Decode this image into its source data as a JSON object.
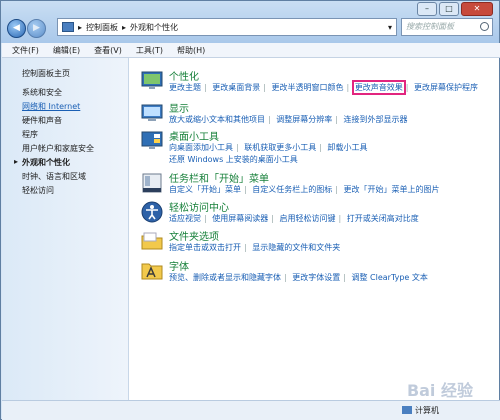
{
  "address": {
    "crumbs": [
      "控制面板",
      "外观和个性化"
    ]
  },
  "search": {
    "placeholder": "搜索控制面板"
  },
  "menubar": [
    "文件(F)",
    "编辑(E)",
    "查看(V)",
    "工具(T)",
    "帮助(H)"
  ],
  "sidebar": {
    "items": [
      {
        "label": "控制面板主页"
      },
      {
        "label": "系统和安全"
      },
      {
        "label": "网络和 Internet"
      },
      {
        "label": "硬件和声音"
      },
      {
        "label": "程序"
      },
      {
        "label": "用户帐户和家庭安全"
      },
      {
        "label": "外观和个性化"
      },
      {
        "label": "时钟、语言和区域"
      },
      {
        "label": "轻松访问"
      }
    ]
  },
  "categories": [
    {
      "title": "个性化",
      "links": [
        "更改主题",
        "更改桌面背景",
        "更改半透明窗口颜色",
        "更改声音效果",
        "更改屏幕保护程序"
      ],
      "icon": "personalization-icon"
    },
    {
      "title": "显示",
      "links": [
        "放大或缩小文本和其他项目",
        "调整屏幕分辨率",
        "连接到外部显示器"
      ],
      "icon": "display-icon"
    },
    {
      "title": "桌面小工具",
      "links": [
        "向桌面添加小工具",
        "联机获取更多小工具",
        "卸载小工具",
        "还原 Windows 上安装的桌面小工具"
      ],
      "icon": "gadgets-icon"
    },
    {
      "title": "任务栏和「开始」菜单",
      "links": [
        "自定义「开始」菜单",
        "自定义任务栏上的图标",
        "更改「开始」菜单上的图片"
      ],
      "icon": "taskbar-icon"
    },
    {
      "title": "轻松访问中心",
      "links": [
        "适应视觉",
        "使用屏幕阅读器",
        "启用轻松访问键",
        "打开或关闭高对比度"
      ],
      "icon": "accessibility-icon"
    },
    {
      "title": "文件夹选项",
      "links": [
        "指定单击或双击打开",
        "显示隐藏的文件和文件夹"
      ],
      "icon": "folder-icon"
    },
    {
      "title": "字体",
      "links": [
        "预览、删除或者显示和隐藏字体",
        "更改字体设置",
        "调整 ClearType 文本"
      ],
      "icon": "fonts-icon"
    }
  ],
  "status": {
    "location": "计算机"
  },
  "watermark": "Bai 经验"
}
